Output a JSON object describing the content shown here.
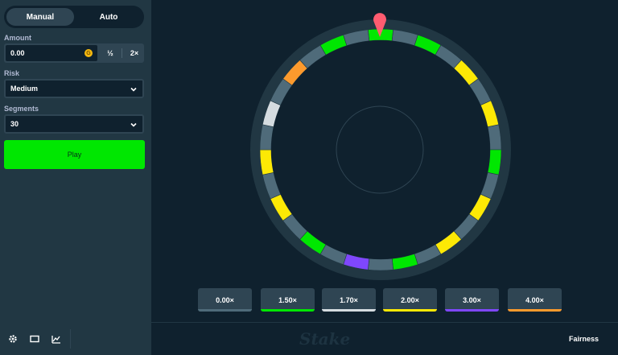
{
  "mode": {
    "manual": "Manual",
    "auto": "Auto",
    "active": "Manual"
  },
  "amount": {
    "label": "Amount",
    "value": "0.00",
    "coin_symbol": "G",
    "half": "½",
    "double": "2×"
  },
  "risk": {
    "label": "Risk",
    "value": "Medium"
  },
  "segments": {
    "label": "Segments",
    "value": "30"
  },
  "play": {
    "label": "Play"
  },
  "footer": {
    "fairness": "Fairness",
    "logo": "Stake",
    "icons": [
      "gear-icon",
      "theatre-mode-icon",
      "stats-icon"
    ]
  },
  "colors": {
    "gray": "#4f6b7a",
    "green": "#00e701",
    "white": "#d5dce0",
    "yellow": "#fde905",
    "purple": "#7f47fd",
    "orange": "#fc9a2d",
    "pointer": "#ff5c70",
    "play": "#00e701"
  },
  "wheel": {
    "segment_count": 30,
    "sequence": [
      "green",
      "gray",
      "green",
      "gray",
      "yellow",
      "gray",
      "yellow",
      "gray",
      "green",
      "gray",
      "yellow",
      "gray",
      "yellow",
      "gray",
      "green",
      "gray",
      "purple",
      "gray",
      "green",
      "gray",
      "yellow",
      "gray",
      "yellow",
      "gray",
      "white",
      "gray",
      "orange",
      "gray",
      "green",
      "gray"
    ]
  },
  "multipliers": [
    {
      "label": "0.00×",
      "color": "#4f6b7a"
    },
    {
      "label": "1.50×",
      "color": "#00e701"
    },
    {
      "label": "1.70×",
      "color": "#d5dce0"
    },
    {
      "label": "2.00×",
      "color": "#fde905"
    },
    {
      "label": "3.00×",
      "color": "#7f47fd"
    },
    {
      "label": "4.00×",
      "color": "#fc9a2d"
    }
  ]
}
